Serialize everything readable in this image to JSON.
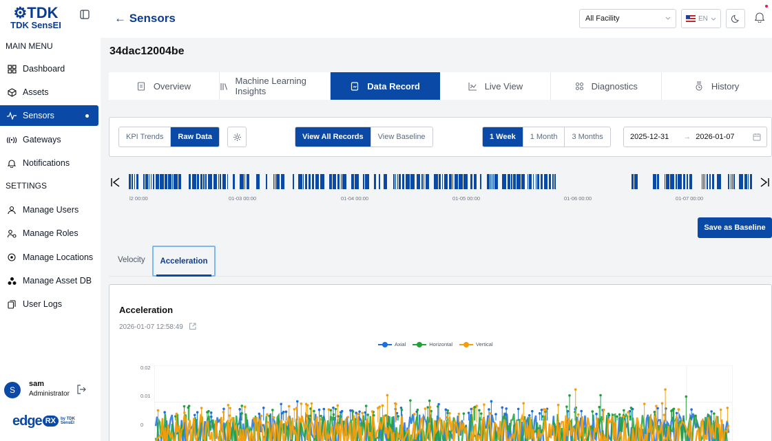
{
  "sidebar": {
    "logo_mark": "TDK",
    "logo_sub": "TDK SensEI",
    "main_menu_title": "MAIN MENU",
    "settings_title": "SETTINGS",
    "items": [
      {
        "label": "Dashboard",
        "icon": "dashboard-icon"
      },
      {
        "label": "Assets",
        "icon": "cube-icon"
      },
      {
        "label": "Sensors",
        "icon": "pulse-icon",
        "active": true
      },
      {
        "label": "Gateways",
        "icon": "wifi-icon"
      },
      {
        "label": "Notifications",
        "icon": "bell-icon"
      }
    ],
    "settings_items": [
      {
        "label": "Manage Users",
        "icon": "user-icon"
      },
      {
        "label": "Manage Roles",
        "icon": "roles-icon"
      },
      {
        "label": "Manage Locations",
        "icon": "location-pin-icon"
      },
      {
        "label": "Manage Asset DB",
        "icon": "asset-db-icon"
      },
      {
        "label": "User Logs",
        "icon": "logs-icon"
      }
    ],
    "user": {
      "initial": "S",
      "name": "sam",
      "role": "Administrator"
    },
    "brand": {
      "name": "edge",
      "rx": "RX",
      "by": "by TDK SensEI"
    }
  },
  "header": {
    "back_label": "← Sensors",
    "facility": "All Facility",
    "language": "EN"
  },
  "device_id": "34dac12004be",
  "tabs": [
    {
      "label": "Overview",
      "icon": "document-icon"
    },
    {
      "label": "Machine Learning Insights",
      "icon": "books-icon"
    },
    {
      "label": "Data Record",
      "icon": "data-file-icon",
      "active": true
    },
    {
      "label": "Live View",
      "icon": "line-chart-icon"
    },
    {
      "label": "Diagnostics",
      "icon": "diagnostics-icon"
    },
    {
      "label": "History",
      "icon": "history-icon"
    }
  ],
  "controls": {
    "kpi_trends": "KPI Trends",
    "raw_data": "Raw Data",
    "view_all_records": "View All Records",
    "view_baseline": "View Baseline",
    "range_1_week": "1 Week",
    "range_1_month": "1 Month",
    "range_3_months": "3 Months",
    "date_start": "2025-12-31",
    "date_end": "2026-01-07"
  },
  "timeline": {
    "ticks": [
      "l2 00:00",
      "01-03 00:00",
      "01-04 00:00",
      "01-05 00:00",
      "01-06 00:00",
      "01-07 00:00"
    ]
  },
  "save_baseline": "Save as Baseline",
  "subtabs": {
    "velocity": "Velocity",
    "acceleration": "Acceleration"
  },
  "chart": {
    "title": "Acceleration",
    "timestamp": "2026-01-07 12:58:49",
    "colors": {
      "Axial": "#1e6fdc",
      "Horizontal": "#20a13a",
      "Vertical": "#f59e0b"
    }
  },
  "chart_data": {
    "type": "line",
    "title": "Acceleration",
    "xlabel": "",
    "ylabel": "",
    "ylim": [
      -0.003,
      0.02
    ],
    "yticks": [
      "0.02",
      "0.01",
      "0"
    ],
    "legend_position": "top-center",
    "series": [
      {
        "name": "Axial",
        "baseline": 0.006,
        "peak": 0.011
      },
      {
        "name": "Horizontal",
        "baseline": 0.006,
        "peak": 0.012
      },
      {
        "name": "Vertical",
        "baseline": 0.0055,
        "peak": 0.014
      }
    ]
  }
}
